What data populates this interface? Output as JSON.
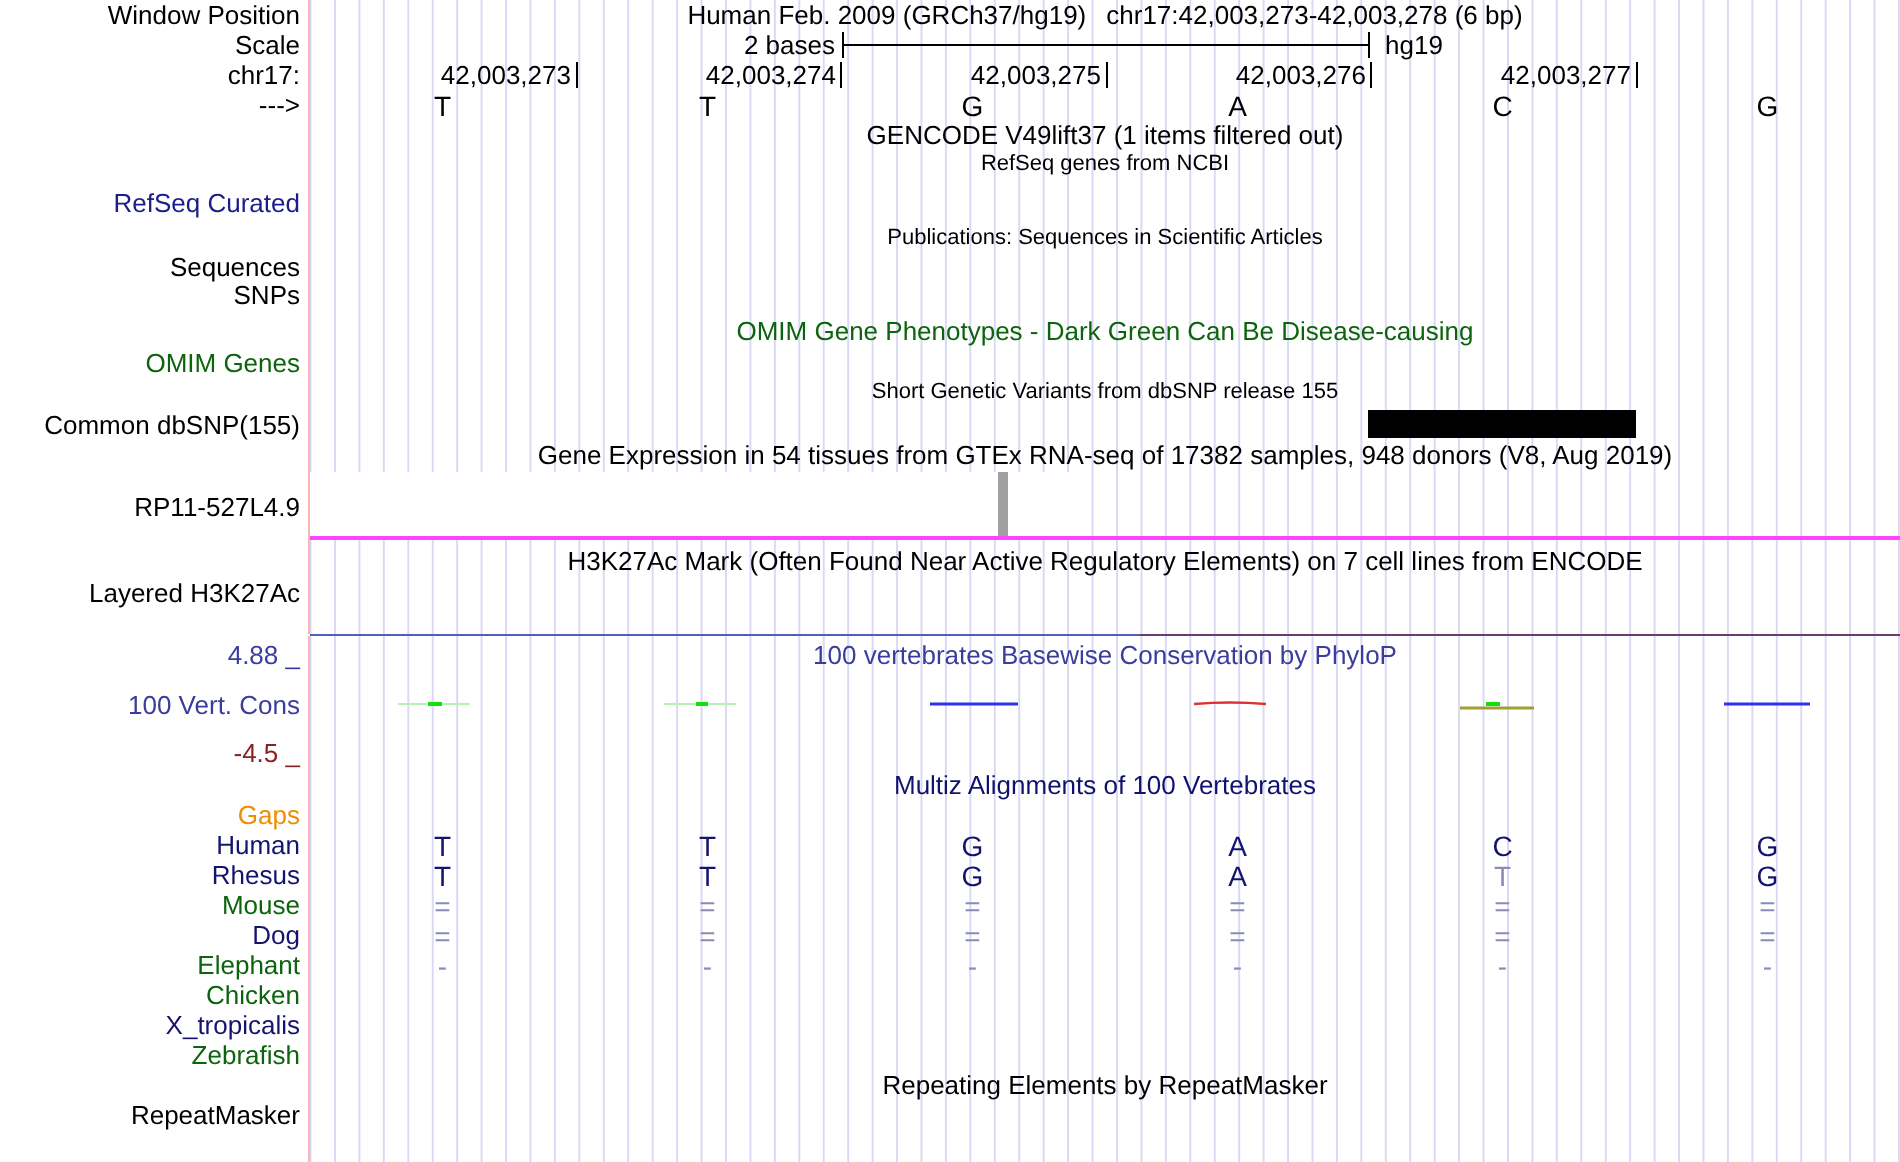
{
  "position": {
    "label": "Window Position",
    "assembly": "Human Feb. 2009 (GRCh37/hg19)",
    "range": "chr17:42,003,273-42,003,278 (6 bp)"
  },
  "scale": {
    "label": "Scale",
    "span": "2 bases",
    "db": "hg19"
  },
  "ruler": {
    "label": "chr17:",
    "ticks": [
      "42,003,273",
      "42,003,274",
      "42,003,275",
      "42,003,276",
      "42,003,277"
    ]
  },
  "bases": {
    "label": "--->",
    "letters": [
      "T",
      "T",
      "G",
      "A",
      "C",
      "G"
    ]
  },
  "tracks": [
    {
      "kind": "genes",
      "title": "GENCODE V49lift37 (1 items filtered out)",
      "color": "#000000"
    },
    {
      "kind": "refseq",
      "title": "RefSeq genes from NCBI",
      "color": "#000000",
      "labels": [
        {
          "text": "RefSeq Curated",
          "color": "#1c1c8c"
        }
      ]
    },
    {
      "kind": "publications",
      "title": "Publications: Sequences in Scientific Articles",
      "color": "#000000",
      "labels": [
        {
          "text": "Sequences",
          "color": "#000000"
        },
        {
          "text": "SNPs",
          "color": "#000000"
        }
      ]
    },
    {
      "kind": "omim",
      "title": "OMIM Gene Phenotypes - Dark Green Can Be Disease-causing",
      "color": "#0c640c",
      "labels": [
        {
          "text": "OMIM Genes",
          "color": "#0c640c"
        }
      ]
    },
    {
      "kind": "dbsnp",
      "title": "Short Genetic Variants from dbSNP release 155",
      "color": "#000000",
      "labels": [
        {
          "text": "Common dbSNP(155)",
          "color": "#000000"
        }
      ]
    },
    {
      "kind": "gtex",
      "title": "Gene Expression in 54 tissues from GTEx RNA-seq of 17382 samples, 948 donors (V8, Aug 2019)",
      "color": "#000000",
      "labels": [
        {
          "text": "RP11-527L4.9",
          "color": "#000000"
        }
      ]
    },
    {
      "kind": "h3k27ac",
      "title": "H3K27Ac Mark (Often Found Near Active Regulatory Elements) on 7 cell lines from ENCODE",
      "color": "#000000",
      "labels": [
        {
          "text": "Layered H3K27Ac",
          "color": "#000000"
        }
      ]
    },
    {
      "kind": "phylop",
      "title": "100 vertebrates Basewise Conservation by PhyloP",
      "color": "#3c3c9c",
      "max": "4.88 _",
      "min": "-4.5 _",
      "labels": [
        {
          "text": "100 Vert. Cons",
          "color": "#3c3c9c"
        }
      ]
    },
    {
      "kind": "multiz",
      "title": "Multiz Alignments of 100 Vertebrates",
      "color": "#12126e",
      "species": [
        {
          "name": "Gaps",
          "color": "#f08c00"
        },
        {
          "name": "Human",
          "color": "#14146e",
          "cells": [
            {
              "text": "T",
              "dim": false
            },
            {
              "text": "T",
              "dim": false
            },
            {
              "text": "G",
              "dim": false
            },
            {
              "text": "A",
              "dim": false
            },
            {
              "text": "C",
              "dim": false
            },
            {
              "text": "G",
              "dim": false
            }
          ]
        },
        {
          "name": "Rhesus",
          "color": "#14146e",
          "cells": [
            {
              "text": "T",
              "dim": false
            },
            {
              "text": "T",
              "dim": false
            },
            {
              "text": "G",
              "dim": false
            },
            {
              "text": "A",
              "dim": false
            },
            {
              "text": "T",
              "dim": true
            },
            {
              "text": "G",
              "dim": false
            }
          ]
        },
        {
          "name": "Mouse",
          "color": "#0c640c",
          "cells": [
            {
              "text": "=",
              "dim": true
            },
            {
              "text": "=",
              "dim": true
            },
            {
              "text": "=",
              "dim": true
            },
            {
              "text": "=",
              "dim": true
            },
            {
              "text": "=",
              "dim": true
            },
            {
              "text": "=",
              "dim": true
            }
          ]
        },
        {
          "name": "Dog",
          "color": "#14146e",
          "cells": [
            {
              "text": "=",
              "dim": true
            },
            {
              "text": "=",
              "dim": true
            },
            {
              "text": "=",
              "dim": true
            },
            {
              "text": "=",
              "dim": true
            },
            {
              "text": "=",
              "dim": true
            },
            {
              "text": "=",
              "dim": true
            }
          ]
        },
        {
          "name": "Elephant",
          "color": "#0c640c",
          "cells": [
            {
              "text": "-",
              "dim": true
            },
            {
              "text": "-",
              "dim": true
            },
            {
              "text": "-",
              "dim": true
            },
            {
              "text": "-",
              "dim": true
            },
            {
              "text": "-",
              "dim": true
            },
            {
              "text": "-",
              "dim": true
            }
          ]
        },
        {
          "name": "Chicken",
          "color": "#0c640c"
        },
        {
          "name": "X_tropicalis",
          "color": "#14146e"
        },
        {
          "name": "Zebrafish",
          "color": "#0c640c"
        }
      ]
    },
    {
      "kind": "repeats",
      "title": "Repeating Elements by RepeatMasker",
      "color": "#000000",
      "labels": [
        {
          "text": "RepeatMasker",
          "color": "#000000"
        }
      ]
    }
  ]
}
